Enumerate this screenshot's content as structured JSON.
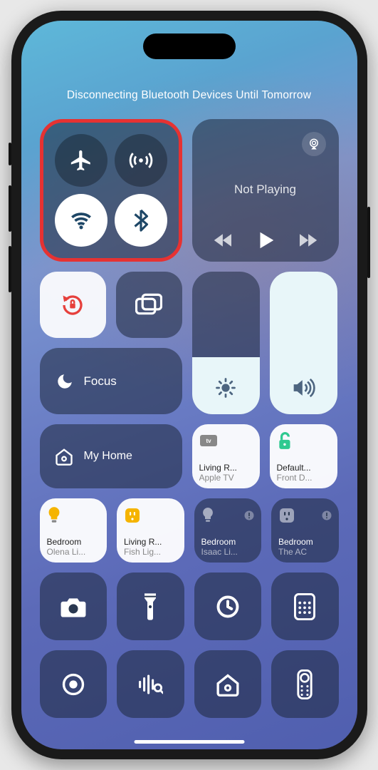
{
  "status_message": "Disconnecting Bluetooth Devices Until Tomorrow",
  "connectivity": {
    "airplane": {
      "enabled": false
    },
    "cellular": {
      "enabled": false
    },
    "wifi": {
      "enabled": true
    },
    "bluetooth": {
      "enabled": true
    }
  },
  "media": {
    "title": "Not Playing"
  },
  "focus": {
    "label": "Focus"
  },
  "brightness": {
    "level_pct": 40
  },
  "volume": {
    "level_pct": 100
  },
  "orientation_lock": {
    "enabled": true
  },
  "screen_mirroring": {
    "enabled": false
  },
  "home": {
    "label": "My Home",
    "tiles": [
      {
        "icon": "appletv",
        "line1": "Living R...",
        "line2": "Apple TV",
        "style": "light"
      },
      {
        "icon": "lock-open",
        "line1": "Default...",
        "line2": "Front D...",
        "style": "light",
        "accent": "#2ec990"
      }
    ],
    "accessories": [
      {
        "icon": "bulb-on",
        "line1": "Bedroom",
        "line2": "Olena Li...",
        "style": "light",
        "accent": "#f5b400"
      },
      {
        "icon": "outlet-on",
        "line1": "Living R...",
        "line2": "Fish Lig...",
        "style": "light",
        "accent": "#f5b400"
      },
      {
        "icon": "bulb-off",
        "line1": "Bedroom",
        "line2": "Isaac Li...",
        "style": "dark",
        "alert": true
      },
      {
        "icon": "outlet-off",
        "line1": "Bedroom",
        "line2": "The AC",
        "style": "dark",
        "alert": true
      }
    ]
  },
  "shortcuts_row1": [
    "camera",
    "flashlight",
    "timer",
    "calculator"
  ],
  "shortcuts_row2": [
    "screen-record",
    "sound-recognition",
    "home",
    "apple-tv-remote"
  ]
}
